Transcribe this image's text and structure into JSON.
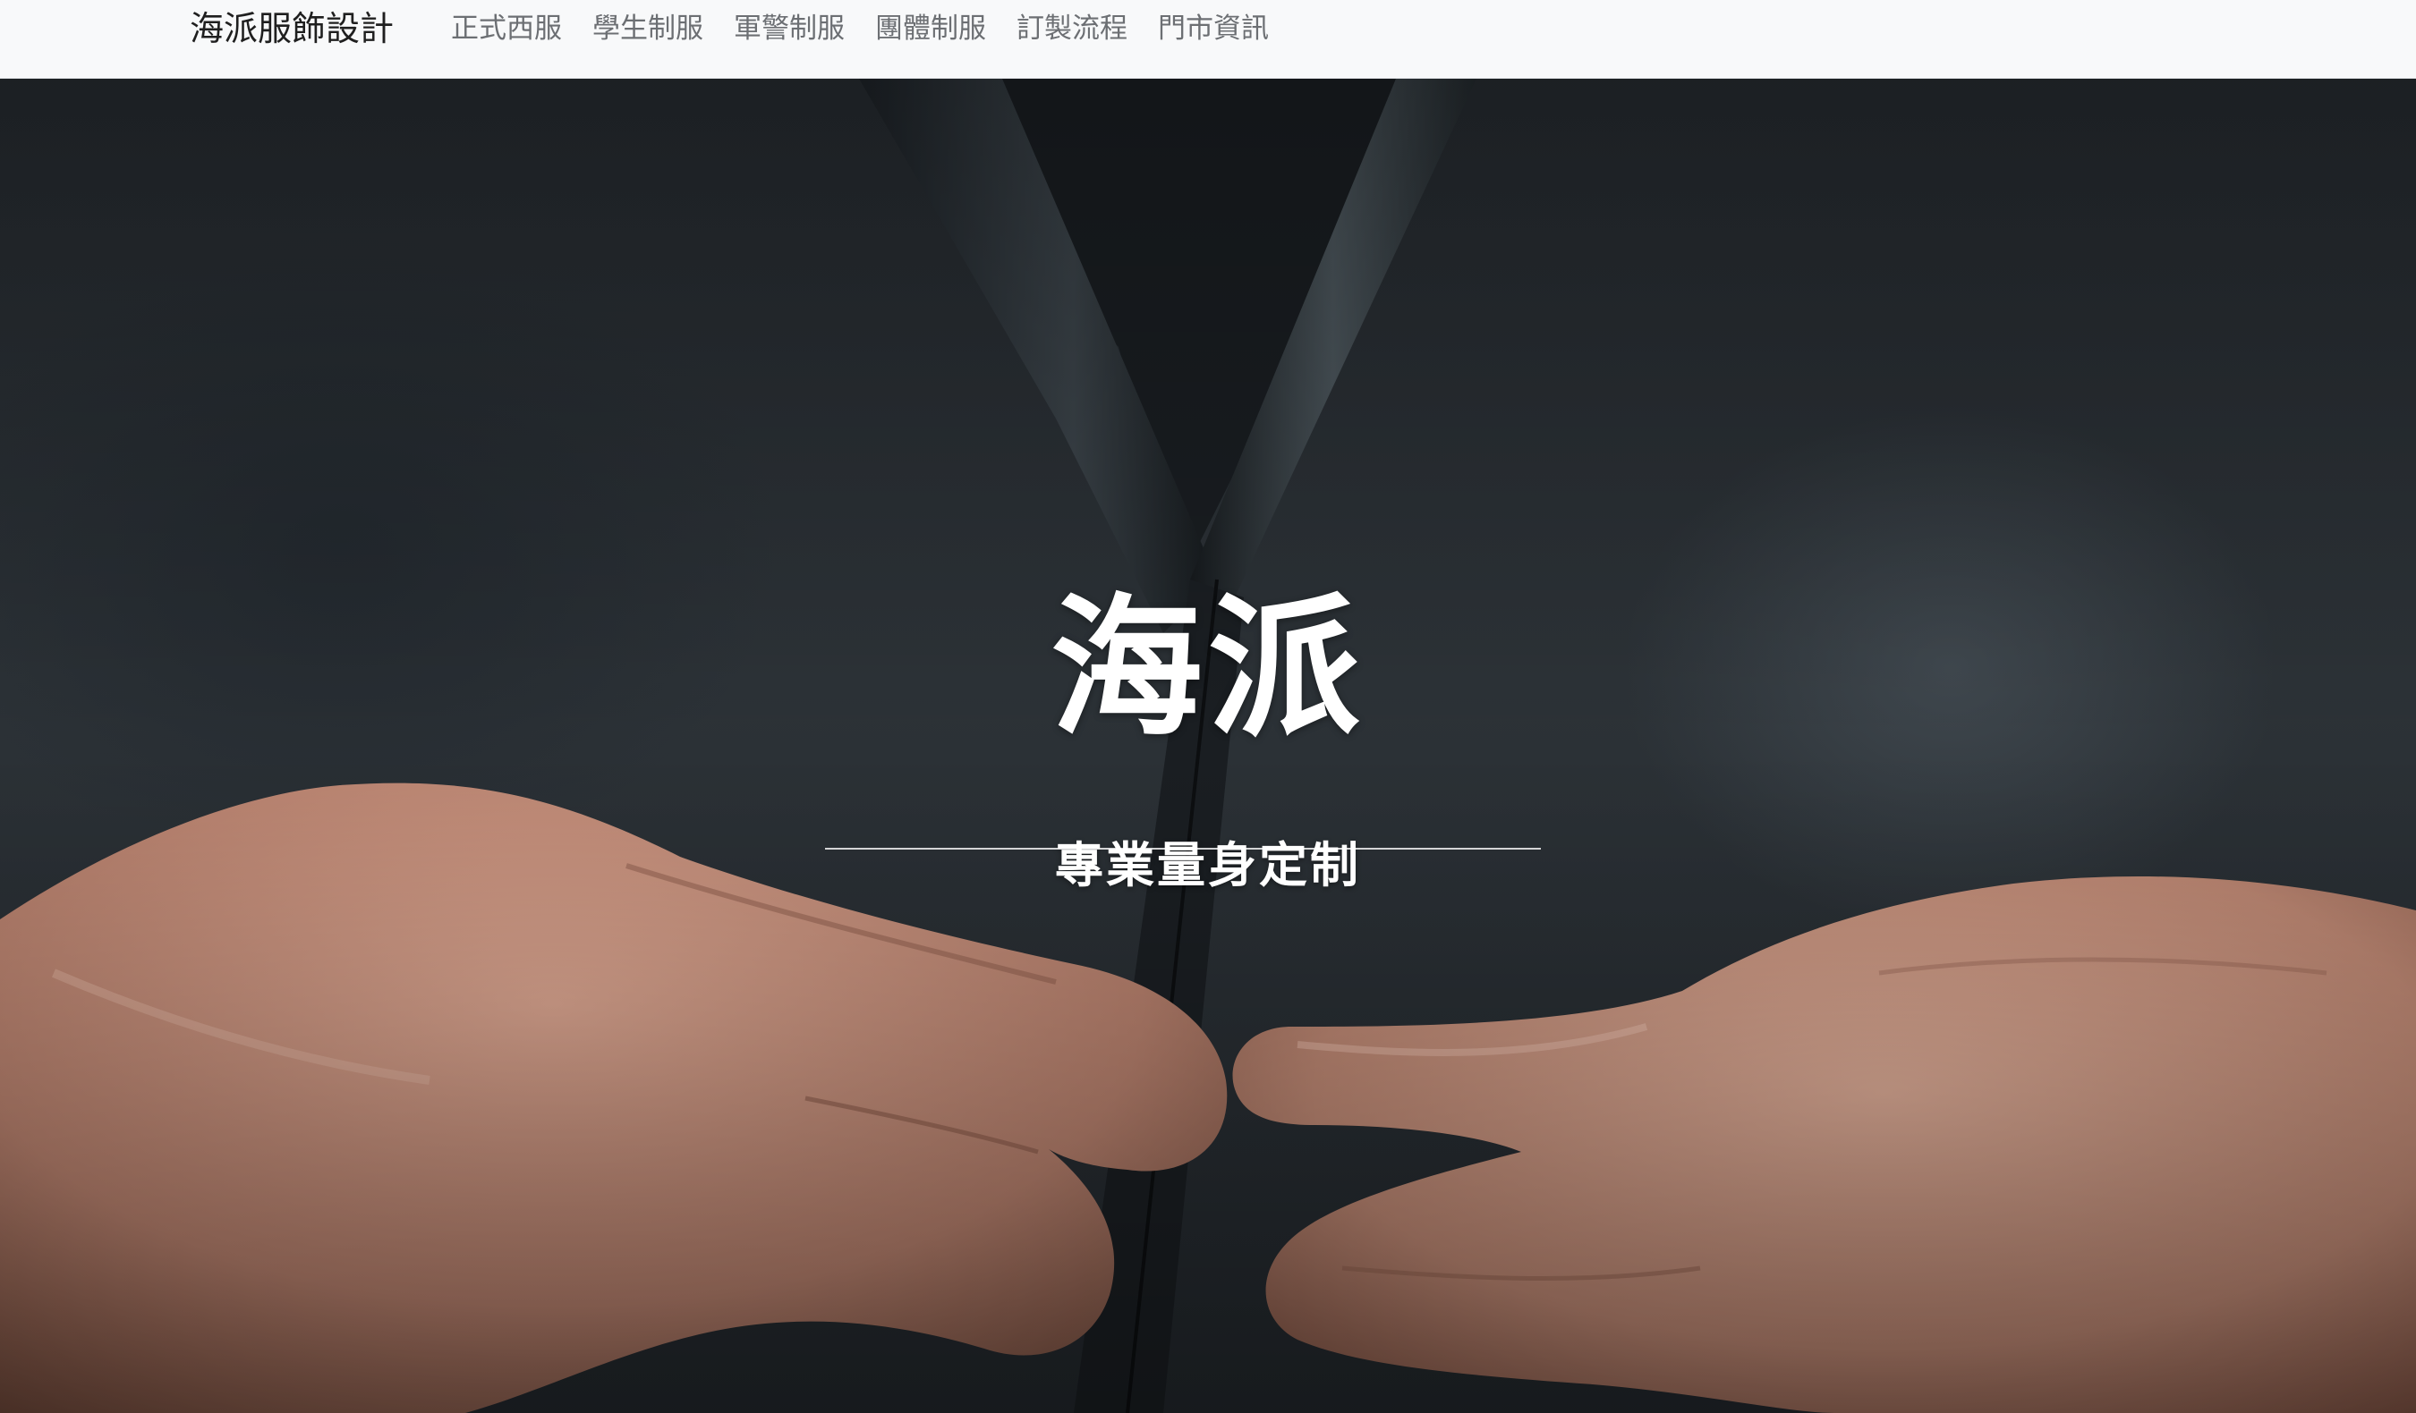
{
  "navbar": {
    "brand": "海派服飾設計",
    "links": [
      {
        "label": "正式西服"
      },
      {
        "label": "學生制服"
      },
      {
        "label": "軍警制服"
      },
      {
        "label": "團體制服"
      },
      {
        "label": "訂製流程"
      },
      {
        "label": "門市資訊"
      }
    ]
  },
  "hero": {
    "title": "海派",
    "subtitle": "專業量身定制",
    "background_description_icon": "suit-button-photo"
  },
  "colors": {
    "navbar_bg": "#f8f9fa",
    "brand_text": "#1f1f1f",
    "nav_link_text": "#6c6f73",
    "hero_text": "#ffffff"
  }
}
